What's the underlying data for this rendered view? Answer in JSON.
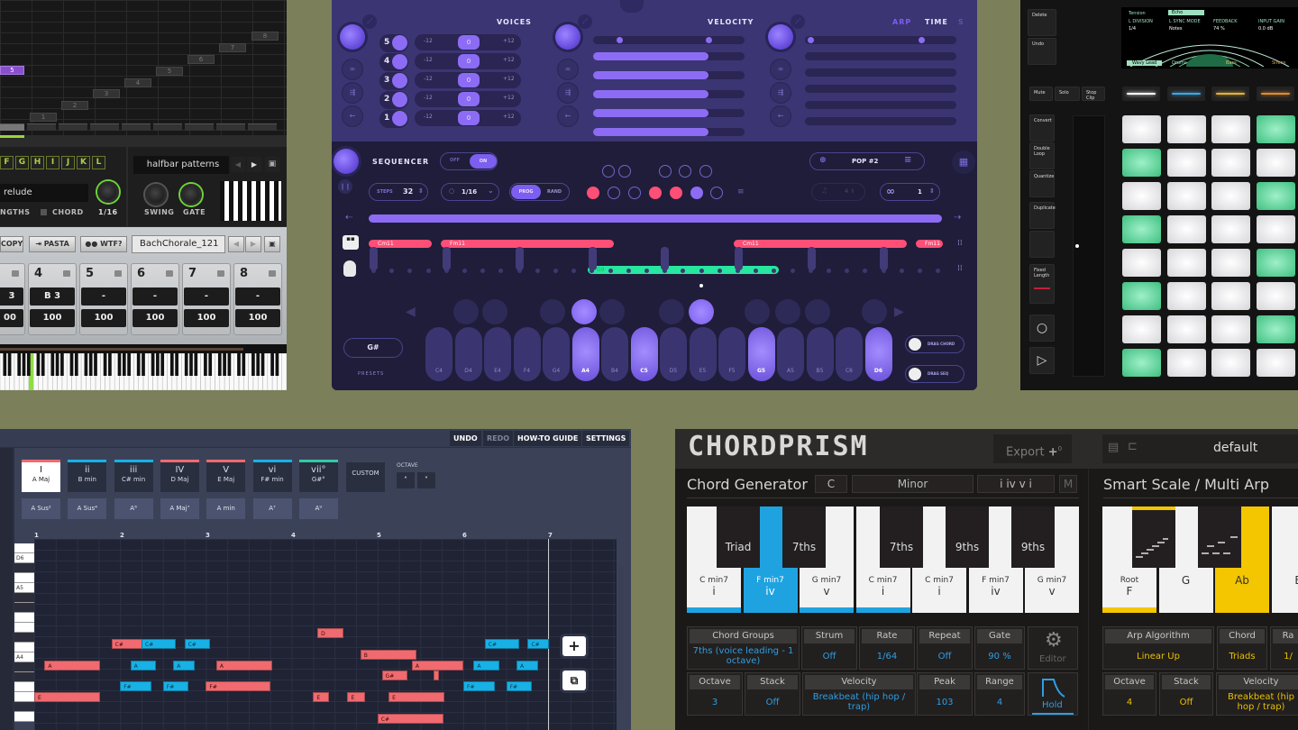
{
  "panel_arp_classic": {
    "step_grid": {
      "highlighted_step": "5",
      "steps": [
        "1",
        "2",
        "3",
        "4",
        "5",
        "6",
        "7",
        "8"
      ]
    },
    "letters": [
      "F",
      "G",
      "H",
      "I",
      "J",
      "K",
      "L"
    ],
    "preset_name": "relude",
    "lengths_label": "NGTHS",
    "chord_label": "CHORD",
    "rate_value": "1/16",
    "pattern_name": "halfbar patterns",
    "swing_label": "SWING",
    "gate_label": "GATE",
    "buttons": {
      "copy": "COPY",
      "pasta": "PASTA",
      "wtf": "WTF?"
    },
    "chorale_preset": "BachChorale_121",
    "columns": [
      {
        "num": "",
        "note": "3",
        "vel": "00"
      },
      {
        "num": "4",
        "note": "B 3",
        "vel": "100"
      },
      {
        "num": "5",
        "note": "-",
        "vel": "100"
      },
      {
        "num": "6",
        "note": "-",
        "vel": "100"
      },
      {
        "num": "7",
        "note": "-",
        "vel": "100"
      },
      {
        "num": "8",
        "note": "-",
        "vel": "100"
      }
    ]
  },
  "panel_purple": {
    "headers": {
      "voices": "VOICES",
      "velocity": "VELOCITY",
      "arp": "ARP",
      "time": "TIME",
      "s": "S"
    },
    "voices": [
      {
        "num": "5",
        "min": "-12",
        "val": "0",
        "max": "+12",
        "velocity": 0.76
      },
      {
        "num": "4",
        "min": "-12",
        "val": "0",
        "max": "+12",
        "velocity": 0.76
      },
      {
        "num": "3",
        "min": "-12",
        "val": "0",
        "max": "+12",
        "velocity": 0.76
      },
      {
        "num": "2",
        "min": "-12",
        "val": "0",
        "max": "+12",
        "velocity": 0.76
      },
      {
        "num": "1",
        "min": "-12",
        "val": "0",
        "max": "+12",
        "velocity": 0.76
      }
    ],
    "sequencer": {
      "label": "SEQUENCER",
      "toggle_off": "OFF",
      "toggle_on": "ON",
      "steps_label": "STEPS",
      "steps_value": "32",
      "rate_value": "1/16",
      "mode_prog": "PROG",
      "mode_rand": "RAND",
      "preset": "POP #2",
      "loop_value": "1",
      "chords_top": [
        "Cm11",
        "Fm11",
        "Cm11",
        "Fm11"
      ],
      "chord_bottom": "G9"
    },
    "keys": {
      "root_label": "G#",
      "presets_label": "PRESETS",
      "notes": [
        "C4",
        "D4",
        "E4",
        "F4",
        "G4",
        "A4",
        "B4",
        "C5",
        "D5",
        "E5",
        "F5",
        "G5",
        "A5",
        "B5",
        "C6",
        "D6"
      ],
      "active": [
        "A4",
        "C5",
        "G5",
        "D6"
      ],
      "drag_chord": "DRAG CHORD",
      "drag_seq": "DRAG SEQ"
    }
  },
  "panel_pads": {
    "side_buttons": [
      "Delete",
      "Undo"
    ],
    "row_buttons": [
      "Mute",
      "Solo",
      "Stop Clip"
    ],
    "left_buttons": [
      "Convert",
      "Double Loop",
      "Quantize",
      "Duplicate",
      "",
      "Fixed Length"
    ],
    "display": {
      "device": "Tension",
      "effect": "Echo",
      "params": [
        {
          "label": "L DIVISION",
          "value": "1/4"
        },
        {
          "label": "L SYNC MODE",
          "value": "Notes"
        },
        {
          "label": "FEEDBACK",
          "value": "74 %"
        },
        {
          "label": "INPUT GAIN",
          "value": "0.0 dB"
        }
      ],
      "tracks": [
        "Wavy Lead",
        "Drums",
        "Bass",
        "Sirens"
      ]
    },
    "strip_colors": [
      "#ffffff",
      "#3fa6e0",
      "#e0b040",
      "#e08a30"
    ],
    "pad_rows": [
      [
        0,
        0,
        0,
        1
      ],
      [
        1,
        0,
        0,
        0
      ],
      [
        0,
        0,
        0,
        1
      ],
      [
        1,
        0,
        0,
        0
      ],
      [
        0,
        0,
        0,
        1
      ],
      [
        1,
        0,
        0,
        0
      ],
      [
        0,
        0,
        0,
        1
      ],
      [
        1,
        0,
        0,
        0
      ]
    ]
  },
  "panel_chord_grid": {
    "toolbar": {
      "undo": "UNDO",
      "redo": "REDO",
      "guide": "HOW-TO GUIDE",
      "settings": "SETTINGS"
    },
    "chords": [
      {
        "roman": "I",
        "name": "A Maj",
        "color": "#f06a6f",
        "selected": true
      },
      {
        "roman": "ii",
        "name": "B min",
        "color": "#17b1e6"
      },
      {
        "roman": "iii",
        "name": "C# min",
        "color": "#17b1e6"
      },
      {
        "roman": "IV",
        "name": "D Maj",
        "color": "#f06a6f"
      },
      {
        "roman": "V",
        "name": "E Maj",
        "color": "#f06a6f"
      },
      {
        "roman": "vi",
        "name": "F# min",
        "color": "#17b1e6"
      },
      {
        "roman": "vii°",
        "name": "G#°",
        "color": "#33c9a7"
      }
    ],
    "custom_label": "CUSTOM",
    "octave_label": "OCTAVE",
    "variations": [
      "A Sus²",
      "A Sus⁴",
      "A⁶",
      "A Maj⁷",
      "A min",
      "A⁷",
      "A⁹"
    ],
    "bars": [
      "1",
      "2",
      "3",
      "4",
      "5",
      "6",
      "7"
    ],
    "piano_labels": {
      "d6": "D6",
      "a5": "A5",
      "a4": "A4"
    },
    "notes": [
      {
        "n": "D",
        "c": "r",
        "x": 3.3,
        "len": 0.3,
        "row": 12
      },
      {
        "n": "C#",
        "c": "r",
        "x": 0.9,
        "len": 0.75,
        "row": 13
      },
      {
        "n": "C#",
        "c": "b",
        "x": 1.25,
        "len": 0.4,
        "row": 13
      },
      {
        "n": "C#",
        "c": "b",
        "x": 1.75,
        "len": 0.3,
        "row": 13
      },
      {
        "n": "C#",
        "c": "b",
        "x": 5.25,
        "len": 0.4,
        "row": 13
      },
      {
        "n": "C#",
        "c": "b",
        "x": 5.75,
        "len": 0.25,
        "row": 13
      },
      {
        "n": "B",
        "c": "r",
        "x": 3.8,
        "len": 0.65,
        "row": 14
      },
      {
        "n": "A",
        "c": "r",
        "x": 0.12,
        "len": 0.65,
        "row": 15
      },
      {
        "n": "A",
        "c": "b",
        "x": 1.12,
        "len": 0.3,
        "row": 15
      },
      {
        "n": "A",
        "c": "b",
        "x": 1.62,
        "len": 0.25,
        "row": 15
      },
      {
        "n": "A",
        "c": "r",
        "x": 2.12,
        "len": 0.65,
        "row": 15
      },
      {
        "n": "A",
        "c": "r",
        "x": 4.4,
        "len": 0.6,
        "row": 15
      },
      {
        "n": "A",
        "c": "b",
        "x": 5.12,
        "len": 0.3,
        "row": 15
      },
      {
        "n": "A",
        "c": "b",
        "x": 5.62,
        "len": 0.25,
        "row": 15
      },
      {
        "n": "G#",
        "c": "r",
        "x": 4.05,
        "len": 0.3,
        "row": 16
      },
      {
        "n": "",
        "c": "r",
        "x": 4.65,
        "len": 0.07,
        "row": 16
      },
      {
        "n": "F#",
        "c": "b",
        "x": 1.0,
        "len": 0.37,
        "row": 17
      },
      {
        "n": "F#",
        "c": "b",
        "x": 1.5,
        "len": 0.3,
        "row": 17
      },
      {
        "n": "F#",
        "c": "r",
        "x": 2.0,
        "len": 0.75,
        "row": 17
      },
      {
        "n": "F#",
        "c": "b",
        "x": 5.0,
        "len": 0.37,
        "row": 17
      },
      {
        "n": "F#",
        "c": "b",
        "x": 5.5,
        "len": 0.3,
        "row": 17
      },
      {
        "n": "E",
        "c": "r",
        "x": 0.0,
        "len": 0.77,
        "row": 18
      },
      {
        "n": "E",
        "c": "r",
        "x": 3.25,
        "len": 0.18,
        "row": 18
      },
      {
        "n": "E",
        "c": "r",
        "x": 3.65,
        "len": 0.2,
        "row": 18
      },
      {
        "n": "E",
        "c": "r",
        "x": 4.13,
        "len": 0.65,
        "row": 18
      },
      {
        "n": "C#",
        "c": "r",
        "x": 4.0,
        "len": 0.77,
        "row": 20
      }
    ]
  },
  "panel_chordprism": {
    "logo": "CHORDPRISM",
    "export_label": "Export",
    "export_badge": "0",
    "preset_name": "default",
    "chord_gen": {
      "title": "Chord Generator",
      "key": "C",
      "scale": "Minor",
      "progression": "i iv v i",
      "m_label": "M",
      "white_keys": [
        {
          "chord": "C min7",
          "deg": "i",
          "state": "under"
        },
        {
          "chord": "F min7",
          "deg": "iv",
          "state": "active"
        },
        {
          "chord": "G min7",
          "deg": "v",
          "state": "under"
        },
        {
          "chord": "C min7",
          "deg": "i",
          "state": "under"
        },
        {
          "chord": "C min7",
          "deg": "i",
          "state": ""
        },
        {
          "chord": "F min7",
          "deg": "iv",
          "state": ""
        },
        {
          "chord": "G min7",
          "deg": "v",
          "state": ""
        }
      ],
      "black_keys": [
        "Triad",
        "7ths",
        "7ths",
        "9ths",
        "9ths"
      ],
      "params_row1": [
        {
          "label": "Chord Groups",
          "value": "7ths (voice leading - 1 octave)"
        },
        {
          "label": "Strum",
          "value": "Off"
        },
        {
          "label": "Rate",
          "value": "1/64"
        },
        {
          "label": "Repeat",
          "value": "Off"
        },
        {
          "label": "Gate",
          "value": "90 %"
        }
      ],
      "params_row2": [
        {
          "label": "Octave",
          "value": "3"
        },
        {
          "label": "Stack",
          "value": "Off"
        },
        {
          "label": "Velocity",
          "value": "Breakbeat (hip hop / trap)"
        },
        {
          "label": "Peak",
          "value": "103"
        },
        {
          "label": "Range",
          "value": "4"
        }
      ],
      "editor_label": "Editor",
      "hold_label": "Hold"
    },
    "arp": {
      "title": "Smart Scale / Multi Arp",
      "keys": [
        {
          "top": "Root",
          "note": "F",
          "state": "under"
        },
        {
          "top": "",
          "note": "G",
          "state": ""
        },
        {
          "top": "",
          "note": "Ab",
          "state": "active"
        },
        {
          "top": "",
          "note": "B",
          "state": ""
        }
      ],
      "params_row1": [
        {
          "label": "Arp Algorithm",
          "value": "Linear Up"
        },
        {
          "label": "Chord",
          "value": "Triads"
        },
        {
          "label": "Ra",
          "value": "1/"
        }
      ],
      "params_row2": [
        {
          "label": "Octave",
          "value": "4"
        },
        {
          "label": "Stack",
          "value": "Off"
        },
        {
          "label": "Velocity",
          "value": "Breakbeat (hip hop / trap)"
        }
      ]
    }
  }
}
